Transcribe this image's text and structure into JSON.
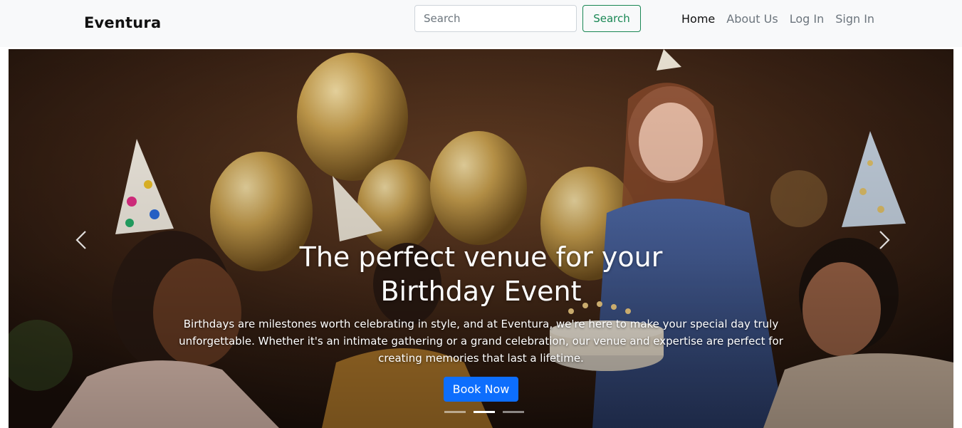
{
  "navbar": {
    "brand": "Eventura",
    "search_placeholder": "Search",
    "search_button": "Search",
    "links": [
      {
        "label": "Home",
        "active": true
      },
      {
        "label": "About Us",
        "active": false
      },
      {
        "label": "Log In",
        "active": false
      },
      {
        "label": "Sign In",
        "active": false
      }
    ]
  },
  "hero": {
    "title": "The perfect venue for your Birthday Event",
    "text": "Birthdays are milestones worth celebrating in style, and at Eventura, we're here to make your special day truly unforgettable. Whether it's an intimate gathering or a grand celebration, our venue and expertise are perfect for creating memories that last a lifetime.",
    "button": "Book Now",
    "slide_count": 3,
    "active_slide": 2
  },
  "icons": {
    "prev": "chevron-left-icon",
    "next": "chevron-right-icon"
  },
  "colors": {
    "navbar_bg": "#f8f9fa",
    "search_button": "#198754",
    "primary_button": "#0d6efd"
  }
}
